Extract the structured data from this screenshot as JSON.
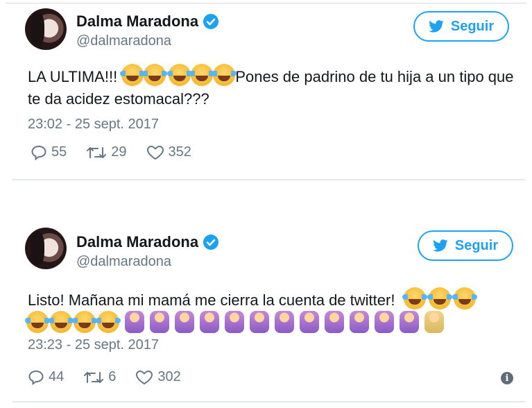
{
  "tweets": [
    {
      "author_name": "Dalma Maradona",
      "author_handle": "@dalmaradona",
      "follow_label": "Seguir",
      "text_prefix": "LA ULTIMA!!! ",
      "text_emojis_inline": [
        "face-with-tears-of-joy",
        "face-with-tears-of-joy",
        "face-with-tears-of-joy",
        "face-with-tears-of-joy",
        "face-with-tears-of-joy"
      ],
      "text_suffix": "Pones de padrino de tu hija a un tipo que te da acidez estomacal???",
      "timestamp": "23:02 - 25 sept. 2017",
      "replies": "55",
      "retweets": "29",
      "likes": "352"
    },
    {
      "author_name": "Dalma Maradona",
      "author_handle": "@dalmaradona",
      "follow_label": "Seguir",
      "text": "Listo! Mañana mi mamá me cierra la cuenta de twitter!",
      "trailing_emojis": [
        "face-with-tears-of-joy",
        "face-with-tears-of-joy",
        "face-with-tears-of-joy"
      ],
      "emoji_line": [
        "face-with-tears-of-joy",
        "face-with-tears-of-joy",
        "face-with-tears-of-joy",
        "face-with-tears-of-joy",
        "woman-facepalming-purple",
        "woman-facepalming-purple",
        "woman-facepalming-purple",
        "woman-facepalming-purple",
        "woman-facepalming-purple",
        "woman-facepalming-purple",
        "woman-facepalming-purple",
        "woman-facepalming-purple",
        "woman-facepalming-purple",
        "woman-facepalming-purple",
        "woman-facepalming-purple",
        "woman-facepalming-purple",
        "woman-facepalming-yellow"
      ],
      "timestamp": "23:23 - 25 sept. 2017",
      "replies": "44",
      "retweets": "6",
      "likes": "302"
    }
  ],
  "colors": {
    "accent": "#1da1f2",
    "text": "#14171a",
    "muted": "#657786"
  },
  "icons": {
    "verified": "verified-badge-icon",
    "follow": "twitter-bird-icon",
    "reply": "reply-icon",
    "retweet": "retweet-icon",
    "like": "heart-icon",
    "info": "info-icon"
  }
}
